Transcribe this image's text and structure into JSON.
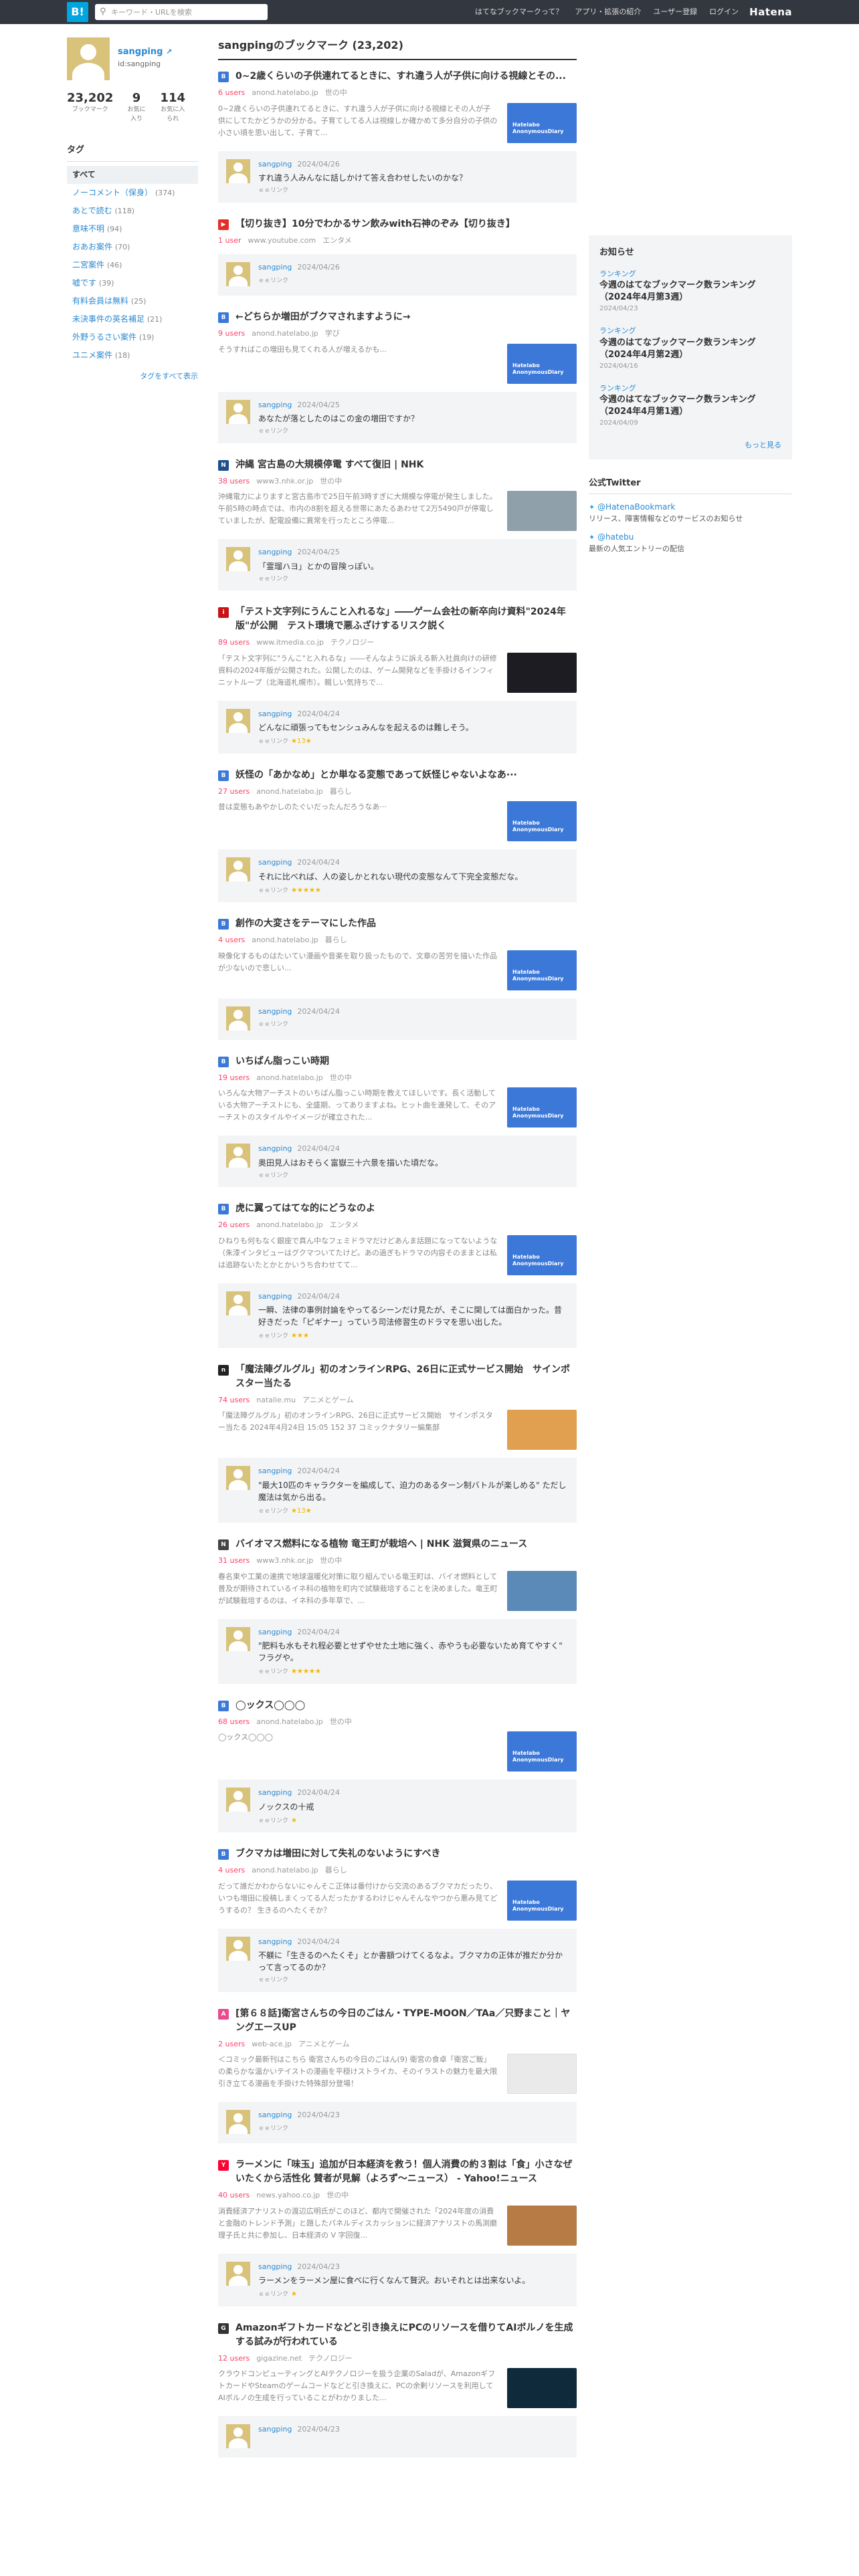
{
  "header": {
    "logo": "B!",
    "search_placeholder": "キーワード・URLを検索",
    "nav": [
      "はてなブックマークって？",
      "アプリ・拡張の紹介",
      "ユーザー登録",
      "ログイン"
    ],
    "brand": "Hatena"
  },
  "user": {
    "name": "sangping",
    "ext_icon": "↗",
    "id": "id:sangping",
    "stats": [
      {
        "num": "23,202",
        "label": "ブックマーク"
      },
      {
        "num": "9",
        "label": "お気に入り"
      },
      {
        "num": "114",
        "label": "お気に入られ"
      }
    ]
  },
  "tags": {
    "heading": "タグ",
    "items": [
      {
        "name": "すべて",
        "count": ""
      },
      {
        "name": "ノーコメント（保身）",
        "count": "(374)"
      },
      {
        "name": "あとで読む",
        "count": "(118)"
      },
      {
        "name": "意味不明",
        "count": "(94)"
      },
      {
        "name": "おあお案件",
        "count": "(70)"
      },
      {
        "name": "二宮案件",
        "count": "(46)"
      },
      {
        "name": "嘘です",
        "count": "(39)"
      },
      {
        "name": "有料会員は無料",
        "count": "(25)"
      },
      {
        "name": "未決事件の英名補足",
        "count": "(21)"
      },
      {
        "name": "外野うるさい案件",
        "count": "(19)"
      },
      {
        "name": "ユニメ案件",
        "count": "(18)"
      }
    ],
    "all_link": "タグをすべて表示"
  },
  "main": {
    "title": "sangpingのブックマーク (23,202)",
    "entries": [
      {
        "title": "0~2歳くらいの子供連れてるときに、すれ違う人が子供に向ける視線とその...",
        "users": "6 users",
        "domain": "anond.hatelabo.jp",
        "category": "世の中",
        "excerpt": "0~2歳くらいの子供連れてるときに、すれ違う人が子供に向ける視線とその人が子供にしてたかどうかの分かる。子育てしてる人は視線しか確かめて多分自分の子供の小さい頃を思い出して、子育て...",
        "thumb": "hatena",
        "thumb_text": "Hatelabo AnonymousDiary",
        "favicon": "hatena",
        "comment": {
          "date": "2024/04/26",
          "text": "すれ違う人みんなに話しかけて答え合わせしたいのかな？",
          "link": "ｅｅリンク",
          "stars": ""
        }
      },
      {
        "title": "【切り抜き】10分でわかるサン飲みwith石神のぞみ【切り抜き】",
        "users": "1 user",
        "domain": "www.youtube.com",
        "category": "エンタメ",
        "excerpt": "",
        "thumb": "",
        "thumb_text": "",
        "favicon": "youtube",
        "comment": {
          "date": "2024/04/26",
          "text": "",
          "link": "ｅｅリンク",
          "stars": ""
        }
      },
      {
        "title": "←どちらか増田がブクマされますように→",
        "users": "9 users",
        "domain": "anond.hatelabo.jp",
        "category": "学び",
        "excerpt": "そうすればこの増田も見てくれる人が増えるかも...",
        "thumb": "hatena",
        "thumb_text": "Hatelabo AnonymousDiary",
        "favicon": "hatena",
        "comment": {
          "date": "2024/04/25",
          "text": "あなたが落としたのはこの金の増田ですか？",
          "link": "ｅｅリンク",
          "stars": ""
        }
      },
      {
        "title": "沖縄 宮古島の大規模停電 すべて復旧 | NHK",
        "users": "38 users",
        "domain": "www3.nhk.or.jp",
        "category": "世の中",
        "excerpt": "沖縄電力によりますと宮古島市で25日午前3時すぎに大規模な停電が発生しました。午前5時の時点では、市内の8割を超える世帯にあたるあわせて2万5490戸が停電していましたが、配電設備に異常を行ったところ停電...",
        "thumb": "tv",
        "thumb_text": "",
        "favicon": "nhk",
        "comment": {
          "date": "2024/04/25",
          "text": "「霊瑠ハヨ」とかの冒険っぽい。",
          "link": "ｅｅリンク",
          "stars": ""
        }
      },
      {
        "title": "「テスト文字列にうんこと入れるな」――ゲーム会社の新卒向け資料\"2024年版\"が公開　テスト環境で悪ふざけするリスク説く",
        "users": "89 users",
        "domain": "www.itmedia.co.jp",
        "category": "テクノロジー",
        "excerpt": "「テスト文字列に\"うんこ\"と入れるな」――そんなように訴える新入社員向けの研修資料の2024年版が公開された。公開したのは、ゲーム開発などを手掛けるインフィニットループ（北海道札幌市）。親しい気持ちで...",
        "thumb": "dark",
        "thumb_text": "",
        "favicon": "itmedia",
        "comment": {
          "date": "2024/04/24",
          "text": "どんなに頑張ってもセンシュみんなを起えるのは難しそう。",
          "link": "ｅｅリンク",
          "stars": "★13★"
        }
      },
      {
        "title": "妖怪の「あかなめ」とか単なる変態であって妖怪じゃないよなあ···",
        "users": "27 users",
        "domain": "anond.hatelabo.jp",
        "category": "暮らし",
        "excerpt": "昔は変態もあやかしのたぐいだったんだろうなあ···",
        "thumb": "hatena",
        "thumb_text": "Hatelabo AnonymousDiary",
        "favicon": "hatena",
        "comment": {
          "date": "2024/04/24",
          "text": "それに比べれば、人の姿しかとれない現代の変態なんて下完全変態だな。",
          "link": "ｅｅリンク",
          "stars": "★★★★★"
        }
      },
      {
        "title": "創作の大変さをテーマにした作品",
        "users": "4 users",
        "domain": "anond.hatelabo.jp",
        "category": "暮らし",
        "excerpt": "映像化するものはたいてい漫画や音楽を取り扱ったもので、文章の苦労を描いた作品が少ないので悲しい...",
        "thumb": "hatena",
        "thumb_text": "Hatelabo AnonymousDiary",
        "favicon": "hatena",
        "comment": {
          "date": "2024/04/24",
          "text": "",
          "link": "ｅｅリンク",
          "stars": ""
        }
      },
      {
        "title": "いちばん脂っこい時期",
        "users": "19 users",
        "domain": "anond.hatelabo.jp",
        "category": "世の中",
        "excerpt": "いろんな大物アーチストのいちばん脂っこい時期を教えてほしいです。長く活動している大物アーチストにも、全盛期、ってありますよね。ヒット曲を連発して、そのアーチストのスタイルやイメージが確立された...",
        "thumb": "hatena",
        "thumb_text": "Hatelabo AnonymousDiary",
        "favicon": "hatena",
        "comment": {
          "date": "2024/04/24",
          "text": "奥田見人はおそらく富嶽三十六景を描いた頃だな。",
          "link": "ｅｅリンク",
          "stars": ""
        }
      },
      {
        "title": "虎に翼ってはてな的にどうなのよ",
        "users": "26 users",
        "domain": "anond.hatelabo.jp",
        "category": "エンタメ",
        "excerpt": "ひねりも何もなく銀座で真ん中なフェミドラマだけどあんま話題になってないような（朱漆インタビューはグクマついてたけど。あの過ぎもドラマの内容そのままとは私は追跡ないたとかとかいうち合わせてて...",
        "thumb": "hatena",
        "thumb_text": "Hatelabo AnonymousDiary",
        "favicon": "hatena",
        "comment": {
          "date": "2024/04/24",
          "text": "一瞬、法律の事例討論をやってるシーンだけ見たが、そこに関しては面白かった。昔好きだった「ピギナー」っていう司法修習生のドラマを思い出した。",
          "link": "ｅｅリンク",
          "stars": "★★★"
        }
      },
      {
        "title": "「魔法陣グルグル」初のオンラインRPG、26日に正式サービス開始　サインポスター当たる",
        "users": "74 users",
        "domain": "natalie.mu",
        "category": "アニメとゲーム",
        "excerpt": "「魔法陣グルグル」初のオンラインRPG、26日に正式サービス開始　サインポスター当たる 2024年4月24日 15:05 152 37 コミックナタリー編集部",
        "thumb": "game",
        "thumb_text": "",
        "favicon": "natalie",
        "comment": {
          "date": "2024/04/24",
          "text": "\"最大10匹のキャラクターを編成して、迫力のあるターン制バトルが楽しめる\" ただし魔法は気から出る。",
          "link": "ｅｅリンク",
          "stars": "★13★"
        }
      },
      {
        "title": "バイオマス燃料になる植物 竜王町が栽培へ | NHK 滋賀県のニュース",
        "users": "31 users",
        "domain": "www3.nhk.or.jp",
        "category": "世の中",
        "excerpt": "春名東や工業の連携で地球温暖化対策に取り組んでいる竜王町は、バイオ燃料として普及が期待されているイネ科の植物を町内で試験栽培することを決めました。竜王町が試験栽培するのは、イネ科の多年草で、...",
        "thumb": "plant",
        "thumb_text": "",
        "favicon": "nhk2",
        "comment": {
          "date": "2024/04/24",
          "text": "\"肥料も水もそれ程必要とせずやせた土地に強く、赤やうも必要ないため育てやすく\" フラグや。",
          "link": "ｅｅリンク",
          "stars": "★★★★★"
        }
      },
      {
        "title": "◯ックス◯◯◯",
        "users": "68 users",
        "domain": "anond.hatelabo.jp",
        "category": "世の中",
        "excerpt": "◯ックス◯◯◯",
        "thumb": "hatena",
        "thumb_text": "Hatelabo AnonymousDiary",
        "favicon": "hatena",
        "comment": {
          "date": "2024/04/24",
          "text": "ノックスの十戒",
          "link": "ｅｅリンク",
          "stars": "★"
        }
      },
      {
        "title": "ブクマカは増田に対して失礼のないようにすべき",
        "users": "4 users",
        "domain": "anond.hatelabo.jp",
        "category": "暮らし",
        "excerpt": "だって誰だかわからないにゃんそこ正体は番付けから交流のあるブクマカだったり、いつも増田に投稿しまくってる人だったかするわけじゃんそんなやつから悪み見てどうするの？ 生きるのへたくそか？",
        "thumb": "hatena",
        "thumb_text": "Hatelabo AnonymousDiary",
        "favicon": "hatena",
        "comment": {
          "date": "2024/04/24",
          "text": "不躾に「生きるのへたくそ」とか書額つけてくるなよ。ブクマカの正体が推だか分かって言ってるのか？",
          "link": "ｅｅリンク",
          "stars": ""
        }
      },
      {
        "title": "[第６８話]衛宮さんちの今日のごはん・TYPE-MOON／TAa／只野まこと｜ヤングエースUP",
        "users": "2 users",
        "domain": "web-ace.jp",
        "category": "アニメとゲーム",
        "excerpt": "＜コミック最新刊はこちら 衛宮さんちの今日のごはん(9) 衛宮の食卓「衛宮ご飯」の柔らかな温かいテイストの漫画を平穏けストライカ、そのイラストの魅力を最大限引き立てる漫画を手掛けた特殊部分登場！",
        "thumb": "anime",
        "thumb_text": "",
        "favicon": "web-ace",
        "comment": {
          "date": "2024/04/23",
          "text": "",
          "link": "ｅｅリンク",
          "stars": ""
        }
      },
      {
        "title": "ラーメンに「味玉」追加が日本経済を救う！個人消費の約３割は「食」小さなぜいたくから活性化 賛者が見解（よろず〜ニュース） - Yahoo!ニュース",
        "users": "40 users",
        "domain": "news.yahoo.co.jp",
        "category": "世の中",
        "excerpt": "消費経済アナリストの渡辺広明氏がこのほど、都内で開催された「2024年度の消費と金融のトレンド予測」と題したパネルディスカッションに経済アナリストの馬渕磨理子氏と共に参加し、日本経済の V 字回復...",
        "thumb": "food",
        "thumb_text": "",
        "favicon": "yahoo",
        "comment": {
          "date": "2024/04/23",
          "text": "ラーメンをラーメン屋に食べに行くなんて贅沢。おいそれとは出来ないよ。",
          "link": "ｅｅリンク",
          "stars": "★"
        }
      },
      {
        "title": "Amazonギフトカードなどと引き換えにPCのリソースを借りてAIボルノを生成する試みが行われている",
        "users": "12 users",
        "domain": "gigazine.net",
        "category": "テクノロジー",
        "excerpt": "クラウドコンピューティングとAIテクノロジーを扱う企業のSaladが、AmazonギフトカードやSteamのゲームコードなどと引き換えに、PCの余剰リソースを利用してAIボルノの生成を行っていることがわかりました...",
        "thumb": "tech",
        "thumb_text": "",
        "favicon": "gigazine",
        "comment": {
          "date": "2024/04/23",
          "text": "",
          "link": "",
          "stars": ""
        }
      }
    ]
  },
  "sidebar": {
    "notice_heading": "お知らせ",
    "news": [
      {
        "category": "ランキング",
        "title": "今週のはてなブックマーク数ランキング（2024年4月第3週）",
        "date": "2024/04/23"
      },
      {
        "category": "ランキング",
        "title": "今週のはてなブックマーク数ランキング（2024年4月第2週）",
        "date": "2024/04/16"
      },
      {
        "category": "ランキング",
        "title": "今週のはてなブックマーク数ランキング（2024年4月第1週）",
        "date": "2024/04/09"
      }
    ],
    "more": "もっと見る",
    "twitter_heading": "公式Twitter",
    "twitter": [
      {
        "account": "@HatenaBookmark",
        "desc": "リリース、障害情報などのサービスのお知らせ"
      },
      {
        "account": "@hatebu",
        "desc": "最新の人気エントリーの配信"
      }
    ]
  },
  "colors": {
    "header_bg": "#333740",
    "link": "#2b8ad2",
    "users": "#ff4166",
    "logo_bg": "#00a4de",
    "hatena_thumb": "#3c78d8"
  }
}
